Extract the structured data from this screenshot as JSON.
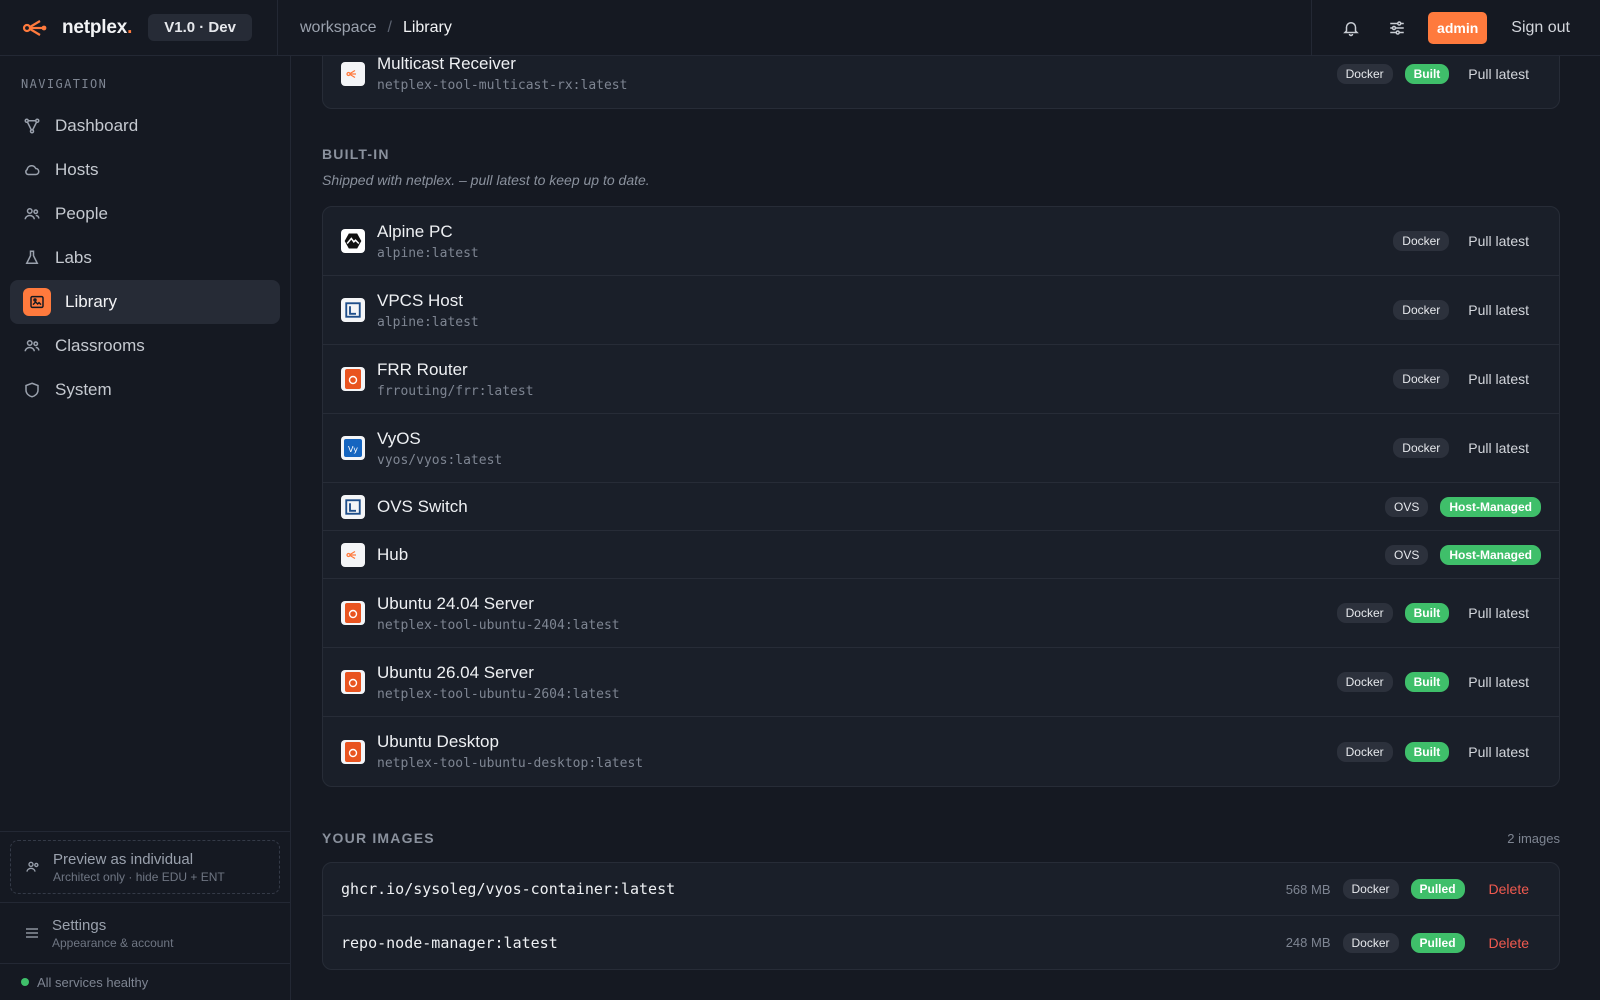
{
  "brand": {
    "name": "netplex",
    "dot": ".",
    "version": "V1.0 · Dev"
  },
  "breadcrumb": {
    "workspace": "workspace",
    "separator": "/",
    "current": "Library"
  },
  "topbar": {
    "role": "admin",
    "signout": "Sign out"
  },
  "nav": {
    "title": "NAVIGATION",
    "items": [
      {
        "label": "Dashboard",
        "icon": "graph-icon"
      },
      {
        "label": "Hosts",
        "icon": "cloud-icon"
      },
      {
        "label": "People",
        "icon": "people-icon"
      },
      {
        "label": "Labs",
        "icon": "flask-icon"
      },
      {
        "label": "Library",
        "icon": "image-icon",
        "active": true
      },
      {
        "label": "Classrooms",
        "icon": "people-icon"
      },
      {
        "label": "System",
        "icon": "shield-icon"
      }
    ]
  },
  "sidebar_bottom": {
    "preview_title": "Preview as individual",
    "preview_sub": "Architect only · hide EDU + ENT",
    "settings_title": "Settings",
    "settings_sub": "Appearance & account",
    "health": "All services healthy"
  },
  "top_card": {
    "name": "Multicast Receiver",
    "image": "netplex-tool-multicast-rx:latest",
    "type": "Docker",
    "status": "Built",
    "action": "Pull latest"
  },
  "builtin": {
    "title": "BUILT-IN",
    "subtitle": "Shipped with netplex. – pull latest to keep up to date.",
    "items": [
      {
        "name": "Alpine PC",
        "image": "alpine:latest",
        "type": "Docker",
        "status": "",
        "action": "Pull latest",
        "icon": "alpine-icon"
      },
      {
        "name": "VPCS Host",
        "image": "alpine:latest",
        "type": "Docker",
        "status": "",
        "action": "Pull latest",
        "icon": "box-icon"
      },
      {
        "name": "FRR Router",
        "image": "frrouting/frr:latest",
        "type": "Docker",
        "status": "",
        "action": "Pull latest",
        "icon": "ubuntu-icon"
      },
      {
        "name": "VyOS",
        "image": "vyos/vyos:latest",
        "type": "Docker",
        "status": "",
        "action": "Pull latest",
        "icon": "vyos-icon"
      },
      {
        "name": "OVS Switch",
        "image": "",
        "type": "OVS",
        "status": "Host-Managed",
        "action": "",
        "icon": "box-icon"
      },
      {
        "name": "Hub",
        "image": "",
        "type": "OVS",
        "status": "Host-Managed",
        "action": "",
        "icon": "netplex-icon"
      },
      {
        "name": "Ubuntu 24.04 Server",
        "image": "netplex-tool-ubuntu-2404:latest",
        "type": "Docker",
        "status": "Built",
        "action": "Pull latest",
        "icon": "ubuntu-icon"
      },
      {
        "name": "Ubuntu 26.04 Server",
        "image": "netplex-tool-ubuntu-2604:latest",
        "type": "Docker",
        "status": "Built",
        "action": "Pull latest",
        "icon": "ubuntu-icon"
      },
      {
        "name": "Ubuntu Desktop",
        "image": "netplex-tool-ubuntu-desktop:latest",
        "type": "Docker",
        "status": "Built",
        "action": "Pull latest",
        "icon": "ubuntu-icon"
      }
    ]
  },
  "your_images": {
    "title": "YOUR IMAGES",
    "count": "2 images",
    "items": [
      {
        "ref": "ghcr.io/sysoleg/vyos-container:latest",
        "size": "568 MB",
        "type": "Docker",
        "status": "Pulled",
        "action": "Delete"
      },
      {
        "ref": "repo-node-manager:latest",
        "size": "248 MB",
        "type": "Docker",
        "status": "Pulled",
        "action": "Delete"
      }
    ]
  },
  "colors": {
    "accent": "#ff7a3d",
    "success": "#3fbf6a",
    "danger": "#f05a4f",
    "bg": "#151922"
  }
}
